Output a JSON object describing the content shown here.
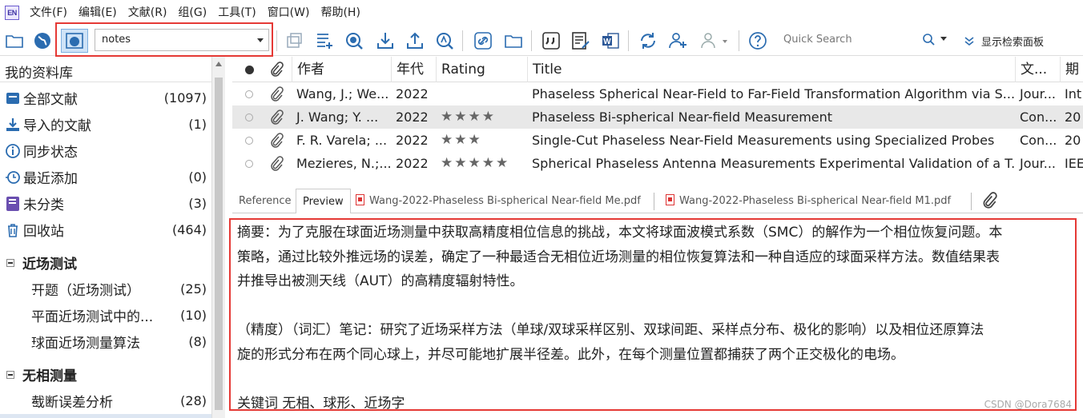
{
  "app_logo": "EN",
  "menu": [
    "文件(F)",
    "编辑(E)",
    "文献(R)",
    "组(G)",
    "工具(T)",
    "窗口(W)",
    "帮助(H)"
  ],
  "toolbar": {
    "group_value": "notes",
    "search_placeholder": "Quick Search",
    "show_panel_label": "显示检索面板"
  },
  "sidebar": {
    "title": "我的资料库",
    "items": [
      {
        "label": "全部文献",
        "count": "(1097)",
        "icon": "library-icon"
      },
      {
        "label": "导入的文献",
        "count": "(1)",
        "icon": "import-icon"
      },
      {
        "label": "同步状态",
        "count": "",
        "icon": "info-icon"
      },
      {
        "label": "最近添加",
        "count": "(0)",
        "icon": "clock-icon"
      },
      {
        "label": "未分类",
        "count": "(3)",
        "icon": "book-icon"
      },
      {
        "label": "回收站",
        "count": "(464)",
        "icon": "trash-icon"
      }
    ],
    "groups": [
      {
        "title": "近场测试",
        "items": [
          {
            "label": "开题（近场测试）",
            "count": "(25)"
          },
          {
            "label": "平面近场测试中的...",
            "count": "(10)"
          },
          {
            "label": "球面近场测量算法",
            "count": "(8)"
          }
        ]
      },
      {
        "title": "无相测量",
        "items": [
          {
            "label": "截断误差分析",
            "count": "(28)"
          }
        ]
      }
    ]
  },
  "references": {
    "columns": [
      "作者",
      "年代",
      "Rating",
      "Title",
      "文...",
      "期"
    ],
    "rows": [
      {
        "author": "Wang, J.; We...",
        "year": "2022",
        "rating": 0,
        "title": "Phaseless Spherical Near-Field to Far-Field Transformation Algorithm via S...",
        "type": "Jour...",
        "journal": "Int"
      },
      {
        "author": "J. Wang; Y. ...",
        "year": "2022",
        "rating": 4,
        "title": "Phaseless Bi-spherical Near-field Measurement",
        "type": "Con...",
        "journal": "20"
      },
      {
        "author": "F. R. Varela; ...",
        "year": "2022",
        "rating": 3,
        "title": "Single-Cut Phaseless Near-Field Measurements using Specialized Probes",
        "type": "Con...",
        "journal": "20"
      },
      {
        "author": "Mezieres, N.;...",
        "year": "2022",
        "rating": 5,
        "title": "Spherical Phaseless Antenna Measurements Experimental Validation of a T...",
        "type": "Jour...",
        "journal": "IEE"
      }
    ]
  },
  "tabs": [
    "Reference",
    "Preview",
    "Wang-2022-Phaseless Bi-spherical Near-field Me.pdf",
    "Wang-2022-Phaseless Bi-spherical Near-field M1.pdf"
  ],
  "preview": {
    "line1": "摘要：为了克服在球面近场测量中获取高精度相位信息的挑战，本文将球面波模式系数（SMC）的解作为一个相位恢复问题。本",
    "line2": "策略，通过比较外推远场的误差，确定了一种最适合无相位近场测量的相位恢复算法和一种自适应的球面采样方法。数值结果表",
    "line3": "并推导出被测天线（AUT）的高精度辐射特性。",
    "line4": "（精度）（词汇）笔记：研究了近场采样方法（单球/双球采样区别、双球间距、采样点分布、极化的影响）以及相位还原算法",
    "line5": "旋的形式分布在两个同心球上，并尽可能地扩展半径差。此外，在每个测量位置都捕获了两个正交极化的电场。",
    "line6": "关键词 无相、球形、近场字"
  },
  "watermark": "CSDN @Dora7684"
}
